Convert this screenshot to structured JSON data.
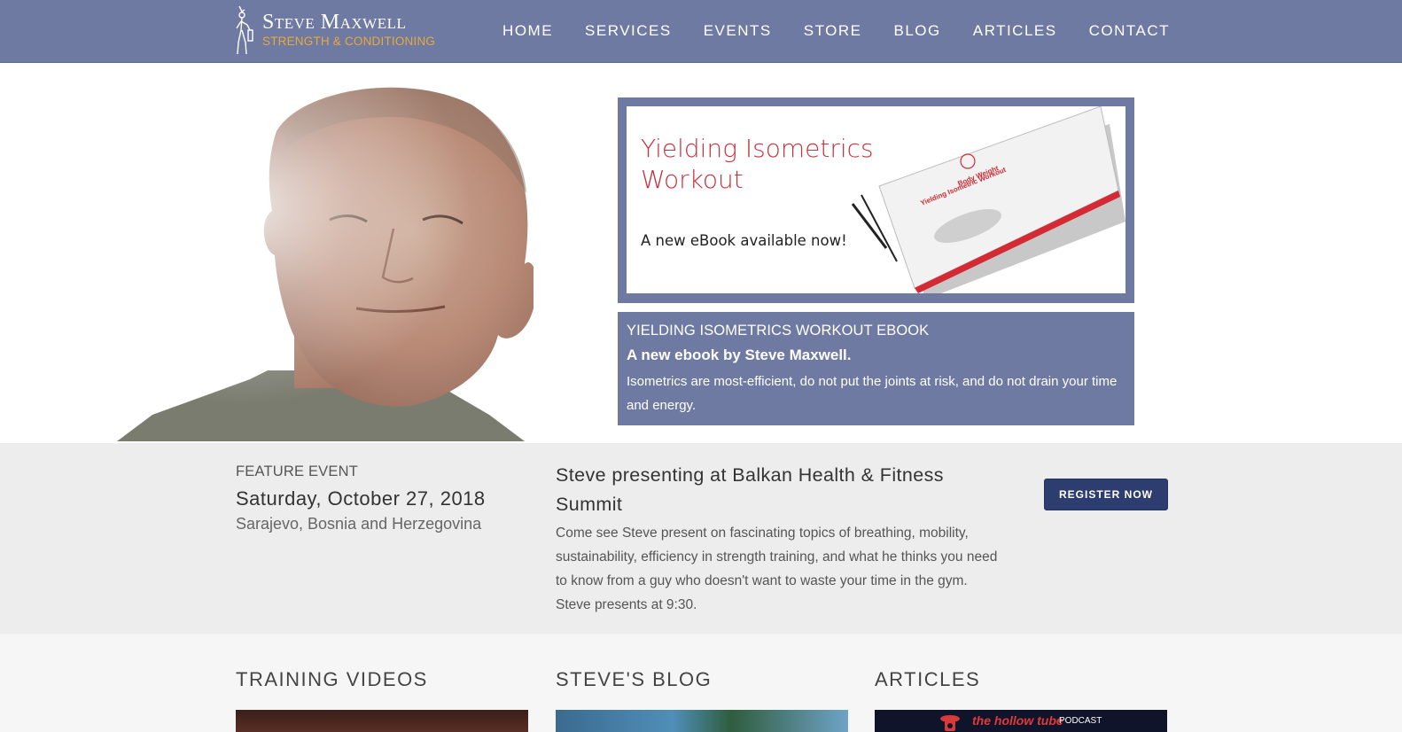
{
  "header": {
    "logo_title": "Steve Maxwell",
    "logo_subtitle": "STRENGTH & CONDITIONING",
    "nav": [
      "HOME",
      "SERVICES",
      "EVENTS",
      "STORE",
      "BLOG",
      "ARTICLES",
      "CONTACT"
    ]
  },
  "hero": {
    "promo_title_line1": "Yielding Isometrics",
    "promo_title_line2": "Workout",
    "promo_subtitle": "A new eBook available now!",
    "book_cover_text_line1": "Body Weight",
    "book_cover_text_line2": "Yielding Isometric Workout",
    "caption_title": "YIELDING ISOMETRICS WORKOUT EBOOK",
    "caption_subtitle": "A new ebook by Steve Maxwell.",
    "caption_text": "Isometrics are most-efficient, do not put the joints at risk, and do not drain your time and energy."
  },
  "event": {
    "label": "FEATURE EVENT",
    "date": "Saturday, October 27, 2018",
    "location": "Sarajevo, Bosnia and Herzegovina",
    "title": "Steve presenting at Balkan Health & Fitness Summit",
    "description": "Come see Steve present on fascinating topics of breathing, mobility, sustainability, efficiency in strength training, and what he thinks you need to know from a guy who doesn't want to waste your time in the gym. Steve presents at 9:30.",
    "register_label": "REGISTER NOW"
  },
  "sections": {
    "videos": "TRAINING VIDEOS",
    "blog": "STEVE'S BLOG",
    "articles": "ARTICLES",
    "podcast_name": "the hollow tube",
    "podcast_tag": "PODCAST"
  },
  "colors": {
    "header_bg": "#6e7aa2",
    "logo_accent": "#e8a93a",
    "promo_red": "#c8323e",
    "button_bg": "#2e3d70",
    "event_bg": "#ededed"
  },
  "icons": [
    "logo-figure-icon"
  ]
}
